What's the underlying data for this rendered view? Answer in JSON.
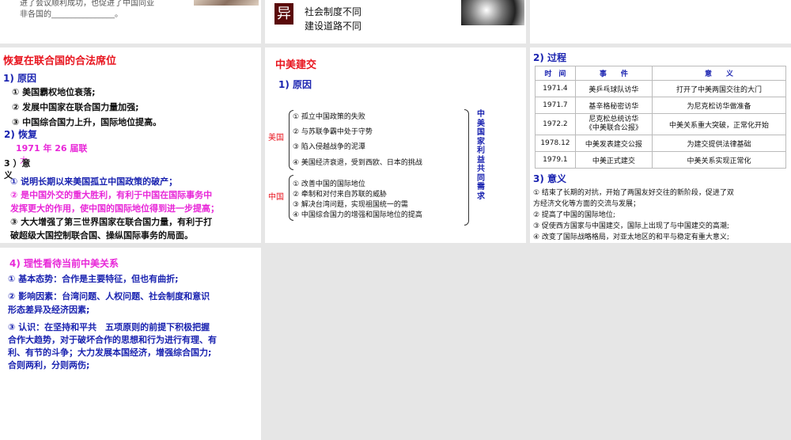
{
  "slides": {
    "top_left": {
      "line1": "进了会议顺利成功，也促进了中国同亚",
      "line2": "非各国的________________。"
    },
    "top_mid": {
      "badge": "异",
      "line1": "社会制度不同",
      "line2": "建设道路不同"
    },
    "un_seat": {
      "title": "恢复在联合国的合法席位",
      "h1": "1) 原因",
      "reasons": [
        "① 美国霸权地位衰落;",
        "② 发展中国家在联合国力量加强;",
        "③ 中国综合国力上升，国际地位提高。"
      ],
      "h2": "2) 恢复",
      "restore": "1971 年 26 届联",
      "restore2": "大",
      "h3a": "3 ）意",
      "h3b": "义",
      "sig": [
        "① 说明长期以来美国孤立中国政策的破产；",
        "② 是中国外交的重大胜利，有利于中国在国际事务中",
        "发挥更大的作用，使中国的国际地位得到进一步提高；",
        "③ 大大增强了第三世界国家在联合国力量，有利于打",
        "破超级大国控制联合国、操纵国际事务的局面。"
      ]
    },
    "establish": {
      "title": "中美建交",
      "h1": "1) 原因",
      "us_label": "美国",
      "us": [
        "① 孤立中国政策的失败",
        "② 与苏联争霸中处于守势",
        "③ 陷入侵越战争的泥潭",
        "④ 美国经济衰退，受到西欧、日本的挑战"
      ],
      "cn_label": "中国",
      "cn": [
        "① 改善中国的国际地位",
        "② 牵制和对付来自苏联的威胁",
        "③ 解决台湾问题，实现祖国统一的需",
        "④ 中国综合国力的增强和国际地位的提高"
      ],
      "side": "中美国家利益共同需求"
    },
    "process": {
      "h2": "2) 过程",
      "headers": [
        "时　间",
        "事　　件",
        "意　　义"
      ],
      "rows": [
        [
          "1971.4",
          "美乒乓球队访华",
          "打开了中美两国交往的大门"
        ],
        [
          "1971.7",
          "基辛格秘密访华",
          "为尼克松访华做准备"
        ],
        [
          "1972.2",
          "尼克松总统访华\n《中美联合公报》",
          "中美关系重大突破，正常化开始"
        ],
        [
          "1978.12",
          "中美发表建交公报",
          "为建交提供法律基础"
        ],
        [
          "1979.1",
          "中美正式建交",
          "中美关系实现正常化"
        ]
      ],
      "h3": "3) 意义",
      "sig": [
        "① 结束了长期的对抗，开始了两国友好交往的新阶段，促进了双",
        "方经济文化等方面的交流与发展；",
        "② 提高了中国的国际地位;",
        "③ 促使西方国家与中国建交，国际上出现了与中国建交的高潮;",
        "④ 改变了国际战略格局，对亚太地区的和平与稳定有重大意义;"
      ]
    },
    "current": {
      "title": "4) 理性看待当前中美关系",
      "p1": "① 基本态势：合作是主要特征，但也有曲折;",
      "p2": [
        "② 影响因素：台湾问题、人权问题、社会制度和意识",
        "形态差异及经济因素;"
      ],
      "p3": [
        "③ 认识：在坚持和平共　五项原则的前提下积极把握",
        "合作大趋势，对于破坏合作的思想和行为进行有理、有",
        "利、有节的斗争；大力发展本国经济，增强综合国力;",
        "合则两利，分则两伤;"
      ]
    }
  },
  "colors": {
    "red": "#e8141e",
    "blue": "#1a23b0",
    "pink": "#e827d8",
    "badge": "#5a0a0a"
  }
}
